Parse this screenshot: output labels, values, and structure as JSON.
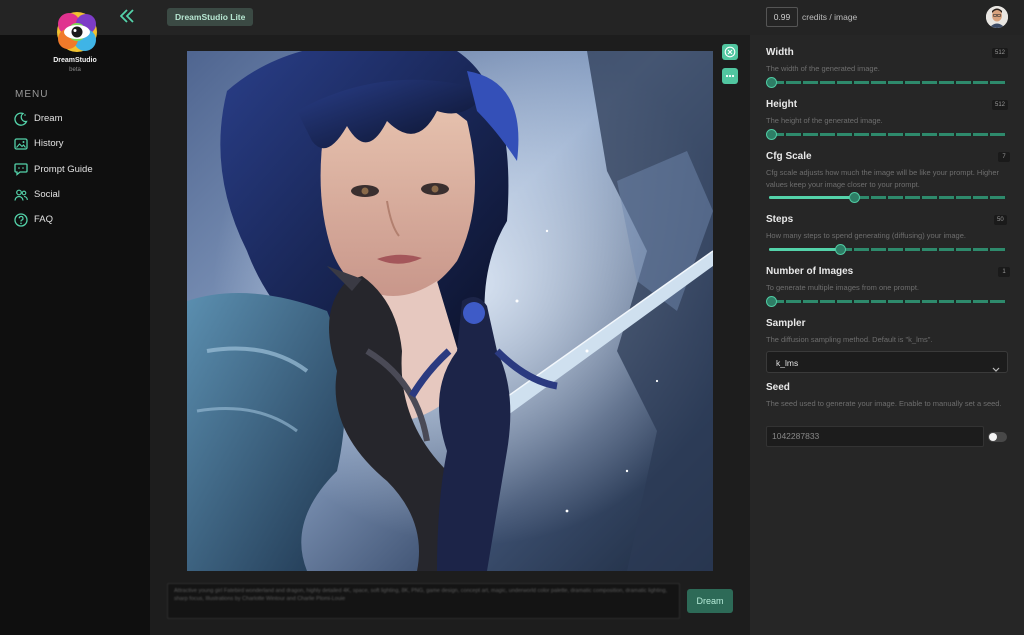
{
  "brand": {
    "name": "DreamStudio",
    "tag": "beta"
  },
  "sidebar": {
    "menu_label": "MENU",
    "items": [
      {
        "label": "Dream",
        "icon": "moon-icon"
      },
      {
        "label": "History",
        "icon": "image-gallery-icon"
      },
      {
        "label": "Prompt Guide",
        "icon": "chat-bubble-icon"
      },
      {
        "label": "Social",
        "icon": "users-icon"
      },
      {
        "label": "FAQ",
        "icon": "question-circle-icon"
      }
    ]
  },
  "header": {
    "app_tag": "DreamStudio Lite",
    "credits_value": "0.99",
    "credits_label": "credits / image"
  },
  "main": {
    "image_alt": "Generated image: blue-haired warrior woman with a sword and a dragon",
    "prompt_text": "Attractive young girl Fatebird wonderland and dragon, highly detailed 4K, space, soft lighting, 8K, PNG, game design, concept art, magic, underworld color palette, dramatic composition, dramatic lighting, sharp focus, Illustrations by Charlotte Wintour and Charlie Plomi-Louie",
    "dream_button": "Dream"
  },
  "settings": {
    "width": {
      "title": "Width",
      "value": "512",
      "description": "The width of the generated image.",
      "level": 0
    },
    "height": {
      "title": "Height",
      "value": "512",
      "description": "The height of the generated image.",
      "level": 0
    },
    "cfg": {
      "title": "Cfg Scale",
      "value": "7",
      "description": "Cfg scale adjusts how much the image will be like your prompt. Higher values keep your image closer to your prompt.",
      "level": 0.35
    },
    "steps": {
      "title": "Steps",
      "value": "50",
      "description": "How many steps to spend generating (diffusing) your image.",
      "level": 0.29
    },
    "num_images": {
      "title": "Number of Images",
      "value": "1",
      "description": "To generate multiple images from one prompt.",
      "level": 0
    },
    "sampler": {
      "title": "Sampler",
      "description": "The diffusion sampling method. Default is \"k_lms\".",
      "selected": "k_lms"
    },
    "seed": {
      "title": "Seed",
      "description": "The seed used to generate your image. Enable to manually set a seed.",
      "value": "1042287833"
    }
  },
  "colors": {
    "accent": "#51c6a0",
    "panel_bg": "#262626",
    "sidebar_bg": "#0f0f0f"
  }
}
